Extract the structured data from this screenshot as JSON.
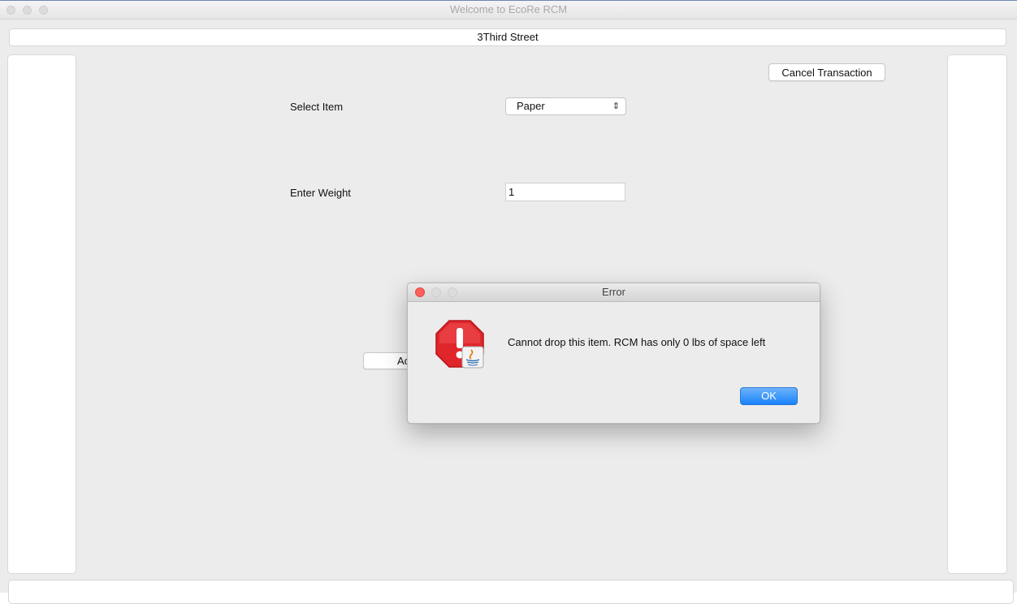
{
  "window": {
    "title": "Welcome to EcoRe RCM",
    "location": "3Third Street"
  },
  "toolbar": {
    "cancel_label": "Cancel Transaction"
  },
  "form": {
    "select_label": "Select Item",
    "select_value": "Paper",
    "weight_label": "Enter Weight",
    "weight_value": "1",
    "add_button_visible_text": "Ac"
  },
  "dialog": {
    "title": "Error",
    "message": "Cannot drop this item. RCM has only 0 lbs of space left",
    "ok_label": "OK",
    "icon": "error-stop-icon"
  },
  "icons": {
    "select_chevron": "up-down-chevron-icon",
    "badge": "java-badge-icon"
  },
  "colors": {
    "error_red": "#e0262b",
    "ok_button_blue": "#1a82fb",
    "window_background": "#ececec"
  }
}
